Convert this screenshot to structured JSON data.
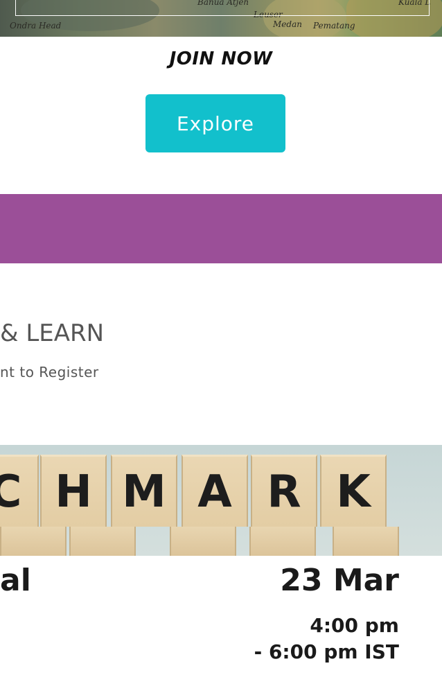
{
  "map_banner": {
    "labels": [
      "Ondra Head",
      "Banua Atjeh",
      "Leuser",
      "Medan",
      "Pematang",
      "Kuala L"
    ]
  },
  "cta": {
    "heading": "JOIN NOW",
    "button_label": "Explore",
    "button_color": "#12c0cc"
  },
  "band_color": "#9b4f98",
  "section": {
    "title": "& LEARN",
    "subtitle": "nt to Register"
  },
  "event_banner": {
    "blocks": [
      "C",
      "H",
      "M",
      "A",
      "R",
      "K"
    ],
    "type_text": "al",
    "date": "23 Mar",
    "time_line1": "4:00 pm",
    "time_line2": "- 6:00 pm IST"
  }
}
